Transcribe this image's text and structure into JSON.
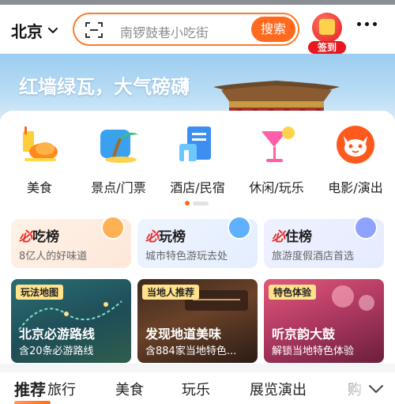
{
  "header": {
    "city": "北京",
    "search_placeholder": "南锣鼓巷小吃街",
    "search_button": "搜索",
    "signin_label": "签到"
  },
  "banner": {
    "headline": "红墙绿瓦，大气磅礴"
  },
  "categories": [
    {
      "label": "美食",
      "icon": "food-icon"
    },
    {
      "label": "景点/门票",
      "icon": "palm-tree-icon"
    },
    {
      "label": "酒店/民宿",
      "icon": "hotel-icon"
    },
    {
      "label": "休闲/玩乐",
      "icon": "cocktail-icon"
    },
    {
      "label": "电影/演出",
      "icon": "cat-face-icon"
    }
  ],
  "pager": {
    "current": 1,
    "total": 2
  },
  "rankings": [
    {
      "prefix": "必",
      "title": "吃榜",
      "subtitle": "8亿人的好味道",
      "color": "#ff8a3d"
    },
    {
      "prefix": "必",
      "title": "玩榜",
      "subtitle": "城市特色游玩去处",
      "color": "#3b8ff0"
    },
    {
      "prefix": "必",
      "title": "住榜",
      "subtitle": "旅游度假酒店首选",
      "color": "#5b72f0"
    }
  ],
  "tiles": [
    {
      "tag": "玩法地图",
      "name": "北京必游路线",
      "desc": "含20条必游路线"
    },
    {
      "tag": "当地人推荐",
      "name": "发现地道美味",
      "desc": "含884家当地特色..."
    },
    {
      "tag": "特色体验",
      "name": "听京韵大鼓",
      "desc": "解锁当地特色体验"
    }
  ],
  "tabs": [
    {
      "label": "推荐",
      "active": true
    },
    {
      "label": "旅行",
      "active": false
    },
    {
      "label": "美食",
      "active": false
    },
    {
      "label": "玩乐",
      "active": false
    },
    {
      "label": "展览演出",
      "active": false
    },
    {
      "label": "购",
      "active": false
    }
  ],
  "colors": {
    "accent": "#ff6a1e",
    "brand_red": "#e8181f"
  }
}
